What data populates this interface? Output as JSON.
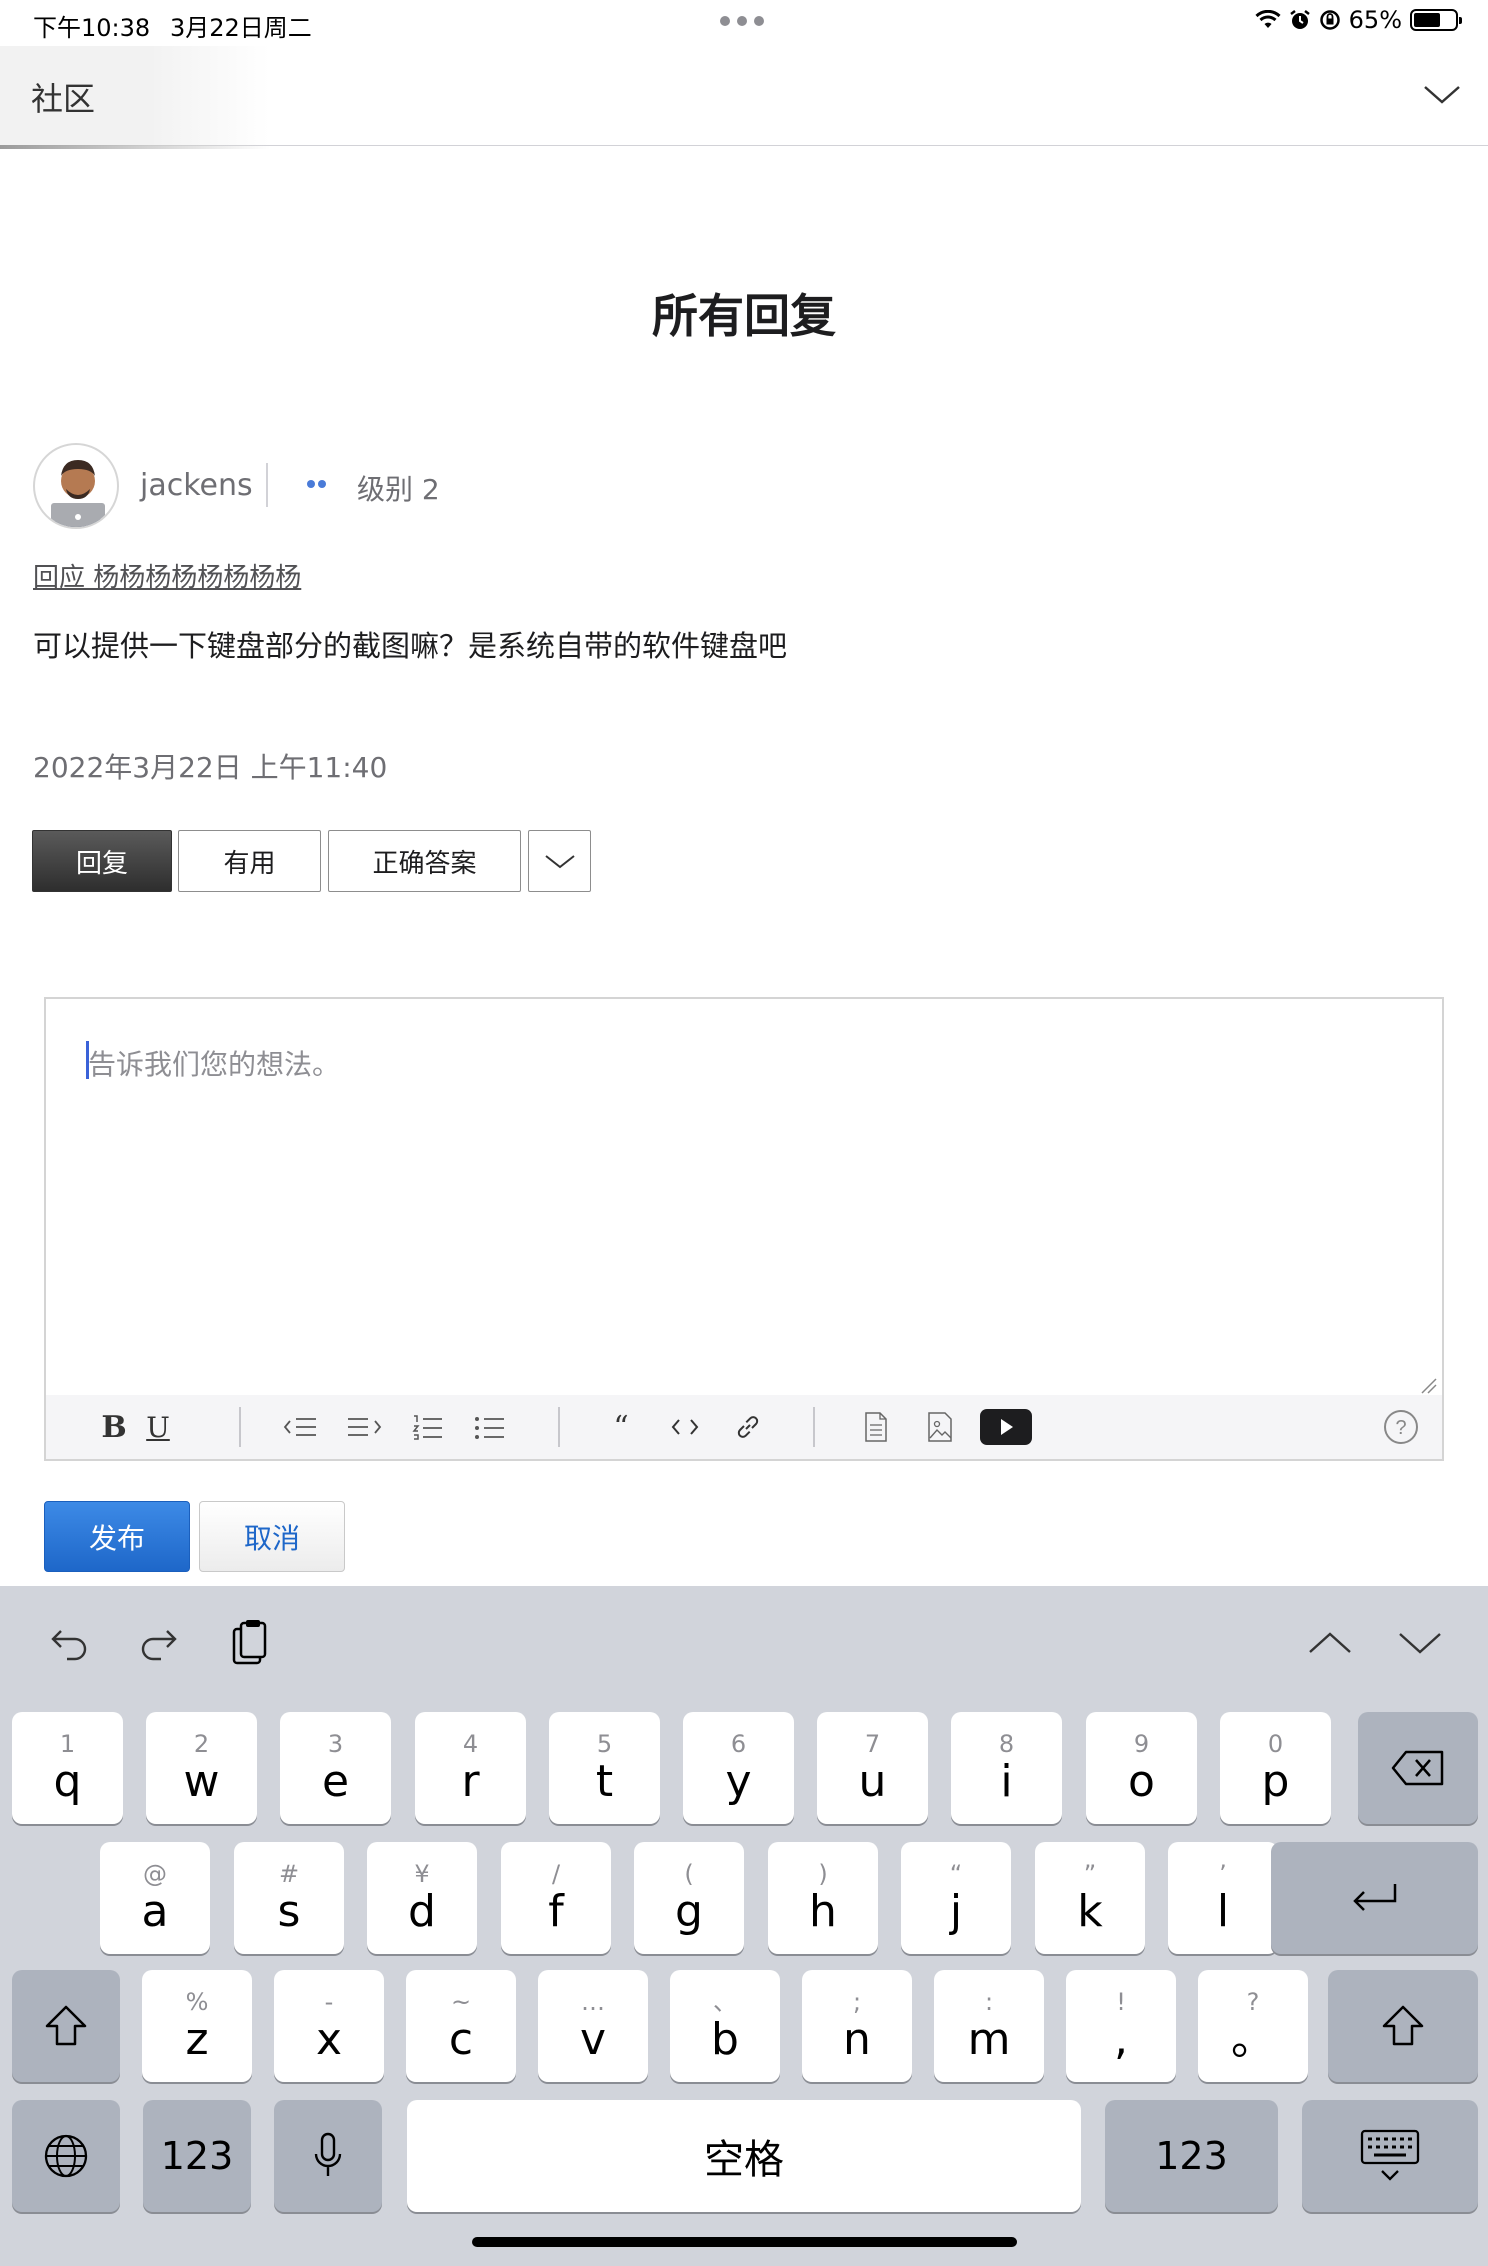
{
  "status_bar": {
    "time": "下午10:38",
    "date": "3月22日周二",
    "battery": "65%",
    "battery_level": 0.65
  },
  "nav": {
    "title": "社区"
  },
  "page": {
    "title": "所有回复"
  },
  "post": {
    "username": "jackens",
    "level": "级别 2",
    "reply_to": "回应 杨杨杨杨杨杨杨杨",
    "body": "可以提供一下键盘部分的截图嘛？是系统自带的软件键盘吧",
    "date": "2022年3月22日 上午11:40",
    "actions": {
      "reply": "回复",
      "useful": "有用",
      "correct": "正确答案"
    }
  },
  "editor": {
    "placeholder": "告诉我们您的想法。",
    "toolbar_icons": [
      "bold-icon",
      "underline-icon",
      "outdent-icon",
      "indent-icon",
      "numbered-list-icon",
      "bulleted-list-icon",
      "quote-icon",
      "code-icon",
      "link-icon",
      "document-icon",
      "image-icon",
      "video-icon",
      "help-icon"
    ]
  },
  "form": {
    "publish": "发布",
    "cancel": "取消"
  },
  "keyboard": {
    "row1": [
      {
        "sub": "1",
        "main": "q"
      },
      {
        "sub": "2",
        "main": "w"
      },
      {
        "sub": "3",
        "main": "e"
      },
      {
        "sub": "4",
        "main": "r"
      },
      {
        "sub": "5",
        "main": "t"
      },
      {
        "sub": "6",
        "main": "y"
      },
      {
        "sub": "7",
        "main": "u"
      },
      {
        "sub": "8",
        "main": "i"
      },
      {
        "sub": "9",
        "main": "o"
      },
      {
        "sub": "0",
        "main": "p"
      }
    ],
    "row2": [
      {
        "sub": "@",
        "main": "a"
      },
      {
        "sub": "#",
        "main": "s"
      },
      {
        "sub": "¥",
        "main": "d"
      },
      {
        "sub": "/",
        "main": "f"
      },
      {
        "sub": "(",
        "main": "g"
      },
      {
        "sub": ")",
        "main": "h"
      },
      {
        "sub": "“",
        "main": "j"
      },
      {
        "sub": "”",
        "main": "k"
      },
      {
        "sub": "’",
        "main": "l"
      }
    ],
    "row3": [
      {
        "sub": "%",
        "main": "z"
      },
      {
        "sub": "-",
        "main": "x"
      },
      {
        "sub": "~",
        "main": "c"
      },
      {
        "sub": "…",
        "main": "v"
      },
      {
        "sub": "、",
        "main": "b"
      },
      {
        "sub": ";",
        "main": "n"
      },
      {
        "sub": ":",
        "main": "m"
      },
      {
        "sub": "!",
        "main": ","
      },
      {
        "sub": "?",
        "main": "。"
      }
    ],
    "numbers_left": "123",
    "space": "空格",
    "numbers_right": "123"
  }
}
